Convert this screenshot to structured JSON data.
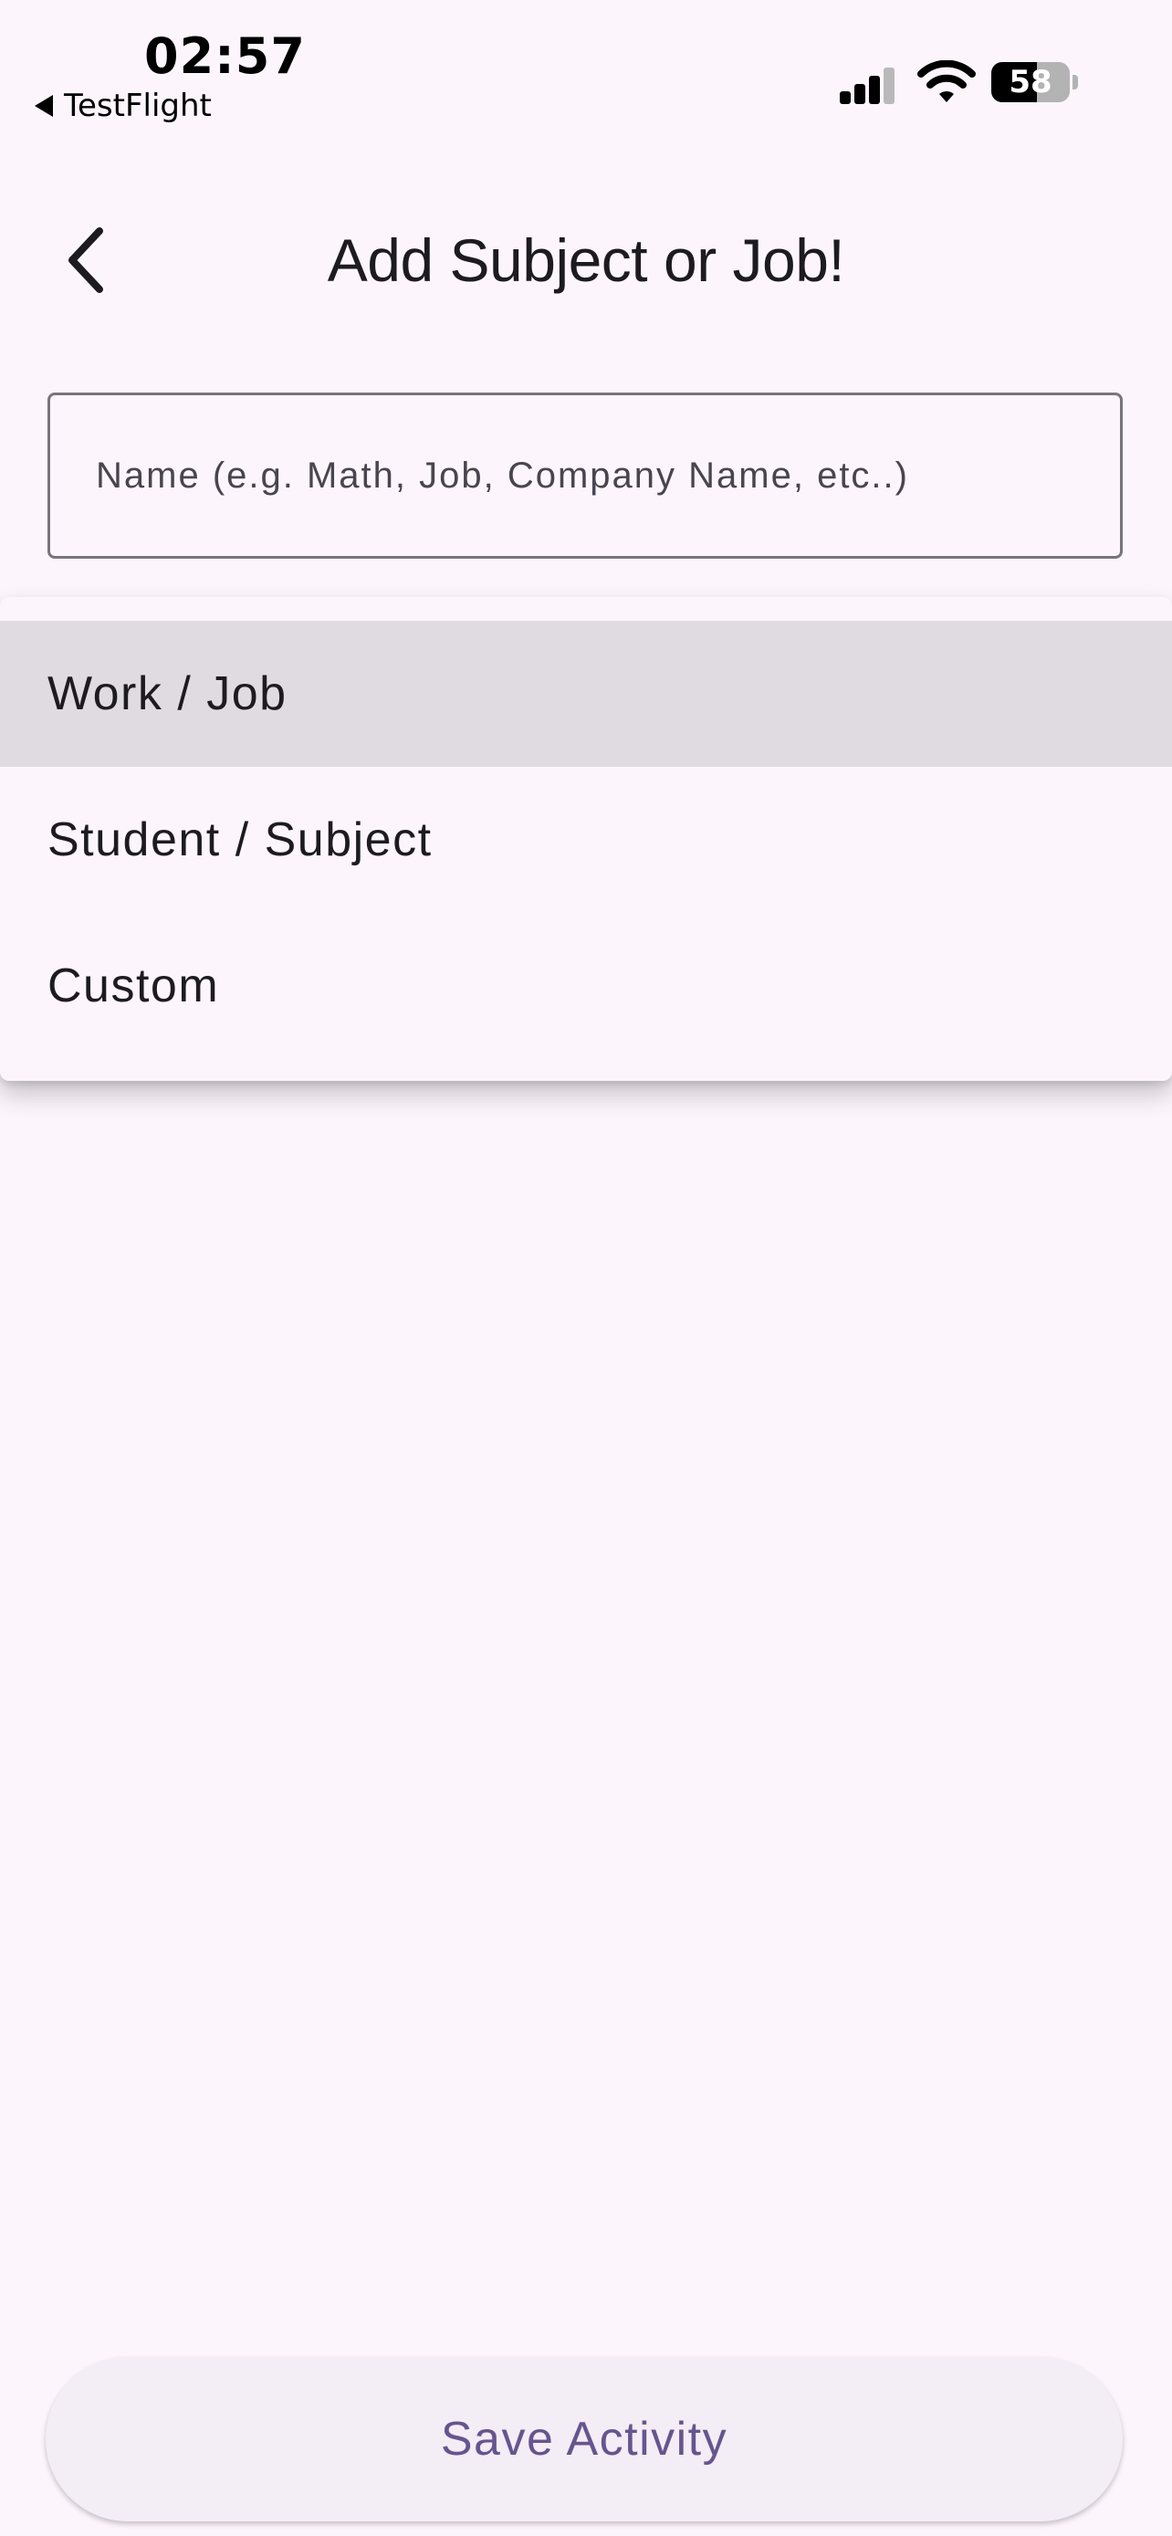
{
  "status_bar": {
    "time": "02:57",
    "back_app_label": "TestFlight",
    "battery_level": "58",
    "icons": [
      "back-triangle-icon",
      "cellular-signal-icon",
      "wifi-icon",
      "battery-icon"
    ]
  },
  "app_bar": {
    "title": "Add Subject or Job!",
    "back_icon": "chevron-left-icon"
  },
  "form": {
    "name_value": "",
    "name_placeholder": "Name (e.g. Math, Job, Company Name, etc..)"
  },
  "menu": {
    "items": [
      {
        "label": "Work / Job",
        "selected": true
      },
      {
        "label": "Student / Subject",
        "selected": false
      },
      {
        "label": "Custom",
        "selected": false
      }
    ]
  },
  "footer": {
    "save_label": "Save Activity"
  },
  "colors": {
    "background": "#fcf6fc",
    "selected_item": "#e0dbe0",
    "button_text": "#65558f",
    "button_bg": "#f3edf5",
    "outline": "#79747e"
  }
}
